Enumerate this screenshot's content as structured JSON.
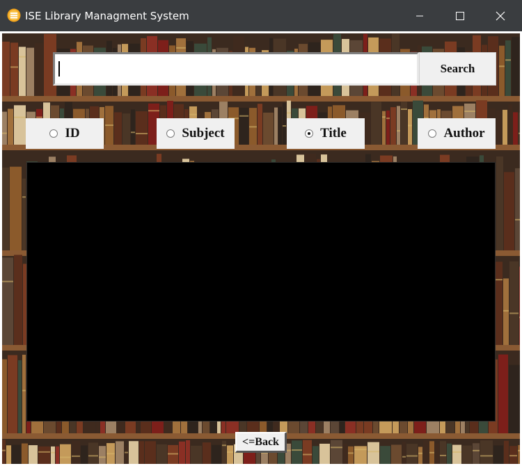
{
  "window": {
    "title": "ISE Library Managment System",
    "icon": "library-app-icon",
    "controls": [
      "minimize-icon",
      "maximize-icon",
      "close-icon"
    ]
  },
  "search": {
    "value": "",
    "button_label": "Search"
  },
  "search_by": {
    "options": [
      {
        "label": "ID",
        "checked": false
      },
      {
        "label": "Subject",
        "checked": false
      },
      {
        "label": "Title",
        "checked": true
      },
      {
        "label": "Author",
        "checked": false
      }
    ]
  },
  "results": {
    "background": "#000000"
  },
  "nav": {
    "back_label": "<=Back"
  },
  "colors": {
    "titlebar": "#3a3d40",
    "control_bg": "#f0f0f0"
  }
}
